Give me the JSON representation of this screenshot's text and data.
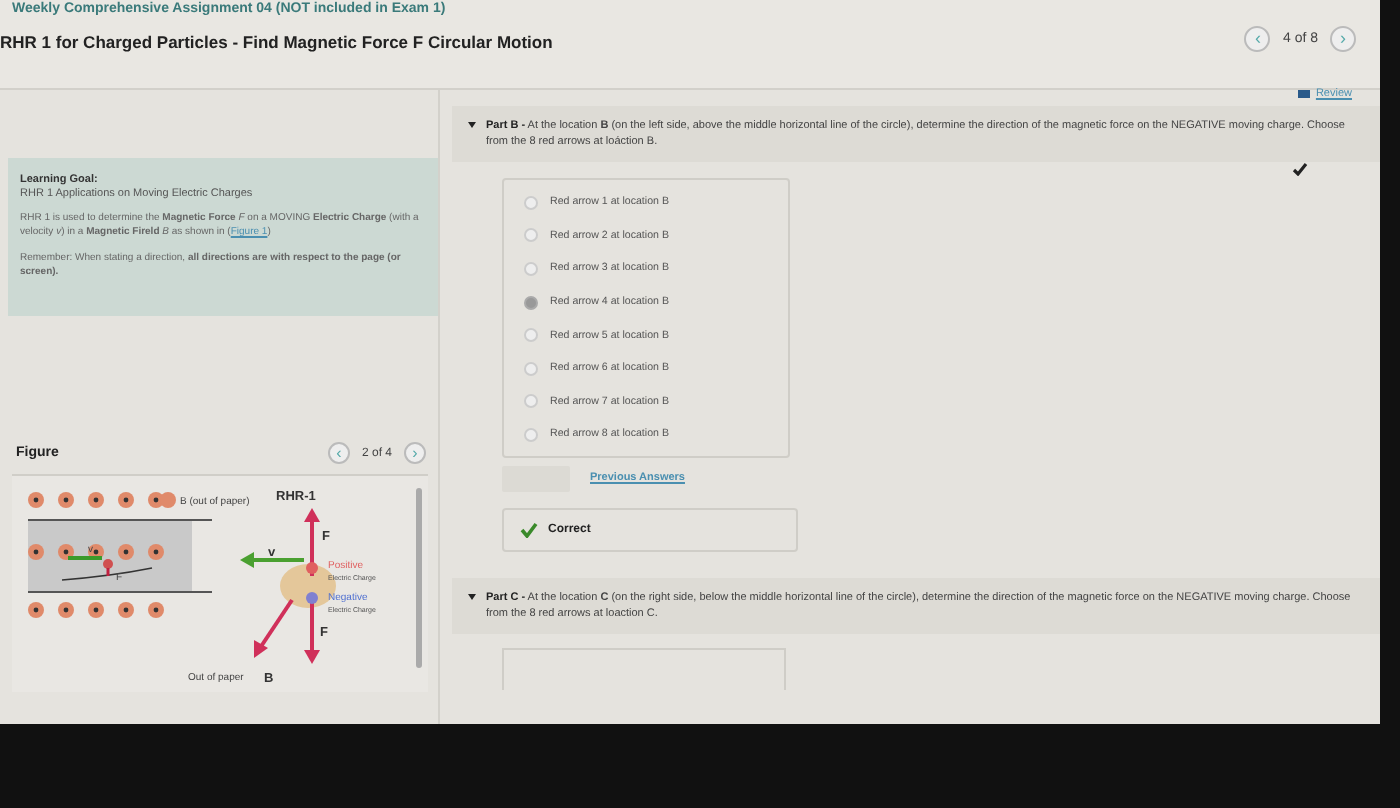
{
  "breadcrumb": "Weekly Comprehensive Assignment 04 (NOT included in Exam 1)",
  "title": "RHR 1 for Charged Particles - Find Magnetic Force F Circular Motion",
  "pager": {
    "prev": "‹",
    "label": "4 of 8",
    "next": "›"
  },
  "learning_goal": {
    "heading": "Learning Goal:",
    "subtitle": "RHR 1 Applications on Moving Electric Charges",
    "text_before": "RHR 1 is used to determine the **Magnetic Force** *F* on a MOVING **Electric Charge** (with a velocity *v*) in a **Magnetic Fireld** *B* as shown in (",
    "link": "Figure 1",
    "text_after": ")",
    "remember": "Remember: When stating a direction, **all directions are with respect to the page (or screen).**"
  },
  "figure": {
    "heading": "Figure",
    "pager": {
      "prev": "‹",
      "label": "2 of 4",
      "next": "›"
    },
    "labels": {
      "field": "B (out of paper)",
      "v_small": "v",
      "f_small": "F",
      "rhr": "RHR-1",
      "v": "v",
      "f_top": "F",
      "positive": "Positive",
      "positive_sub": "Electric Charge",
      "negative": "Negative",
      "negative_sub": "Electric Charge",
      "f_bottom": "F",
      "out": "Out of paper",
      "b": "B"
    }
  },
  "review": "Review",
  "part_b": {
    "label": "Part B -",
    "text": "At the location  **B** (on the left side, above the middle horizontal line of the circle), determine the direction of the magnetic force on the NEGATIVE moving charge. Choose from the 8 red arrows at loáction B.",
    "expanded": true,
    "complete": true,
    "options": [
      {
        "label": "Red arrow 1 at location B",
        "selected": false
      },
      {
        "label": "Red arrow 2 at location B",
        "selected": false
      },
      {
        "label": "Red arrow 3 at location B",
        "selected": false
      },
      {
        "label": "Red arrow 4 at location B",
        "selected": true
      },
      {
        "label": "Red arrow 5 at location B",
        "selected": false
      },
      {
        "label": "Red arrow 6 at location B",
        "selected": false
      },
      {
        "label": "Red arrow 7 at location B",
        "selected": false
      },
      {
        "label": "Red arrow 8 at location B",
        "selected": false
      }
    ],
    "submit_disabled": true,
    "previous_answers": "Previous Answers",
    "feedback": {
      "kind": "correct",
      "text": "Correct"
    }
  },
  "part_c": {
    "label": "Part C -",
    "text": "At the location  **C** (on the right side, below the middle horizontal line of the circle), determine the direction of the magnetic force on the NEGATIVE moving charge. Choose from the 8 red arrows at loaction C.",
    "expanded": true
  }
}
